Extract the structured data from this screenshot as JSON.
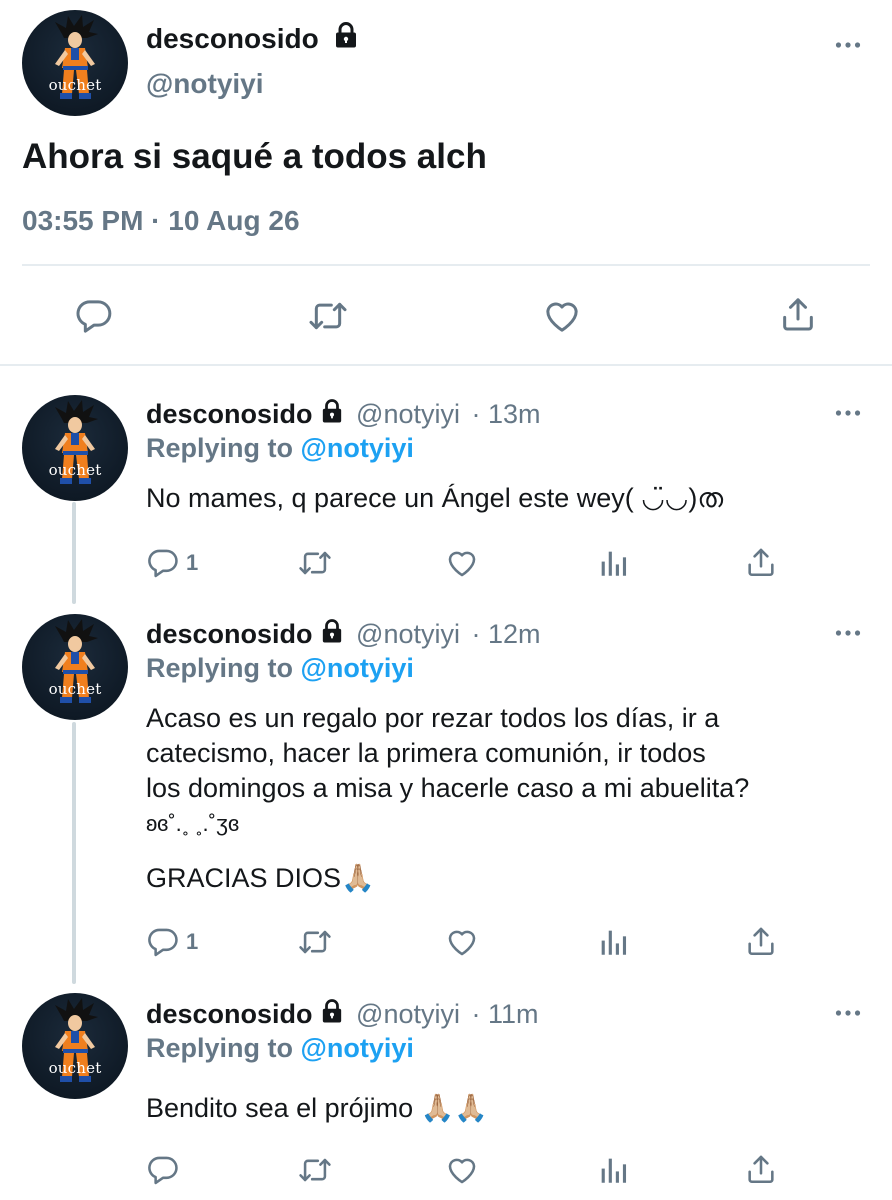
{
  "main_tweet": {
    "display_name": "desconosido",
    "handle": "@notyiyi",
    "avatar_caption": "ouchet",
    "text": "Ahora si saqué a todos alch",
    "timestamp": "03:55 PM · 10 Aug 26"
  },
  "replies": [
    {
      "display_name": "desconosido",
      "handle": "@notyiyi",
      "time": "· 13m",
      "avatar_caption": "ouchet",
      "replying_prefix": "Replying to",
      "replying_handle": "@notyiyi",
      "text": "No mames, q parece un Ángel este wey( ◡̈◡)ത",
      "reply_count": "1"
    },
    {
      "display_name": "desconosido",
      "handle": "@notyiyi",
      "time": "· 12m",
      "avatar_caption": "ouchet",
      "replying_prefix": "Replying to",
      "replying_handle": "@notyiyi",
      "text_lines": [
        "Acaso es un regalo por rezar todos los días, ir a",
        "catecismo, hacer la primera comunión, ir todos",
        "los domingos a misa y hacerle caso a mi abuelita?",
        "ʚɞ˚.˳ ˳.˚ʒɞ",
        "",
        "GRACIAS DIOS🙏🏼"
      ],
      "reply_count": "1"
    },
    {
      "display_name": "desconosido",
      "handle": "@notyiyi",
      "time": "· 11m",
      "avatar_caption": "ouchet",
      "replying_prefix": "Replying to",
      "replying_handle": "@notyiyi",
      "text": "Bendito sea el prójimo 🙏🏼🙏🏼",
      "reply_count": ""
    }
  ],
  "icons": {
    "more": "more-horizontal-icon",
    "reply": "reply-bubble-icon",
    "retweet": "retweet-icon",
    "like": "heart-icon",
    "analytics": "analytics-icon",
    "share": "share-icon",
    "lock": "lock-icon"
  },
  "colors": {
    "link_blue": "#1da1f2",
    "muted_gray": "#657786",
    "text": "#14171a",
    "divider": "#e6ecf0",
    "thread_line": "#cfd9de"
  }
}
